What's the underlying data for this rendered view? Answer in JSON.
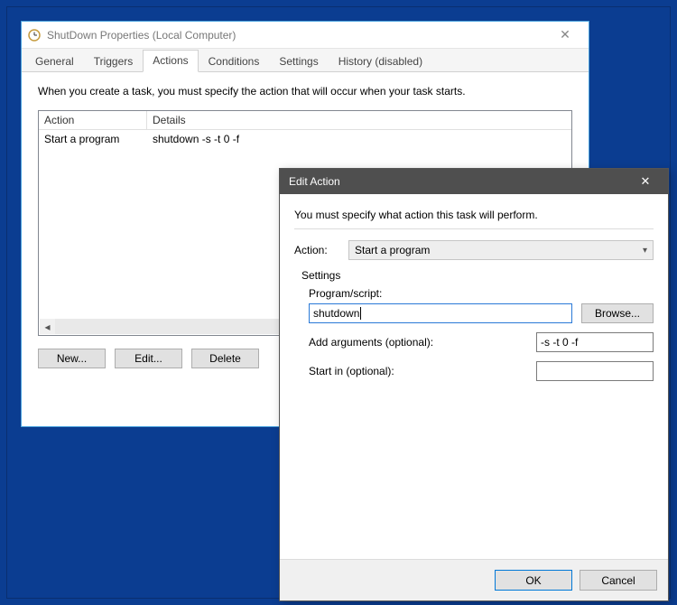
{
  "props": {
    "title": "ShutDown Properties (Local Computer)",
    "intro": "When you create a task, you must specify the action that will occur when your task starts.",
    "tabs": {
      "general": "General",
      "triggers": "Triggers",
      "actions": "Actions",
      "conditions": "Conditions",
      "settings": "Settings",
      "history": "History (disabled)"
    },
    "columns": {
      "action": "Action",
      "details": "Details"
    },
    "rows": [
      {
        "action": "Start a program",
        "details": "shutdown -s -t 0 -f"
      }
    ],
    "buttons": {
      "new": "New...",
      "edit": "Edit...",
      "delete": "Delete"
    }
  },
  "modal": {
    "title": "Edit Action",
    "intro": "You must specify what action this task will perform.",
    "action_label": "Action:",
    "action_value": "Start a program",
    "settings_header": "Settings",
    "program_label": "Program/script:",
    "program_value": "shutdown",
    "browse": "Browse...",
    "args_label": "Add arguments (optional):",
    "args_value": "-s -t 0 -f",
    "startin_label": "Start in (optional):",
    "startin_value": "",
    "ok": "OK",
    "cancel": "Cancel"
  }
}
